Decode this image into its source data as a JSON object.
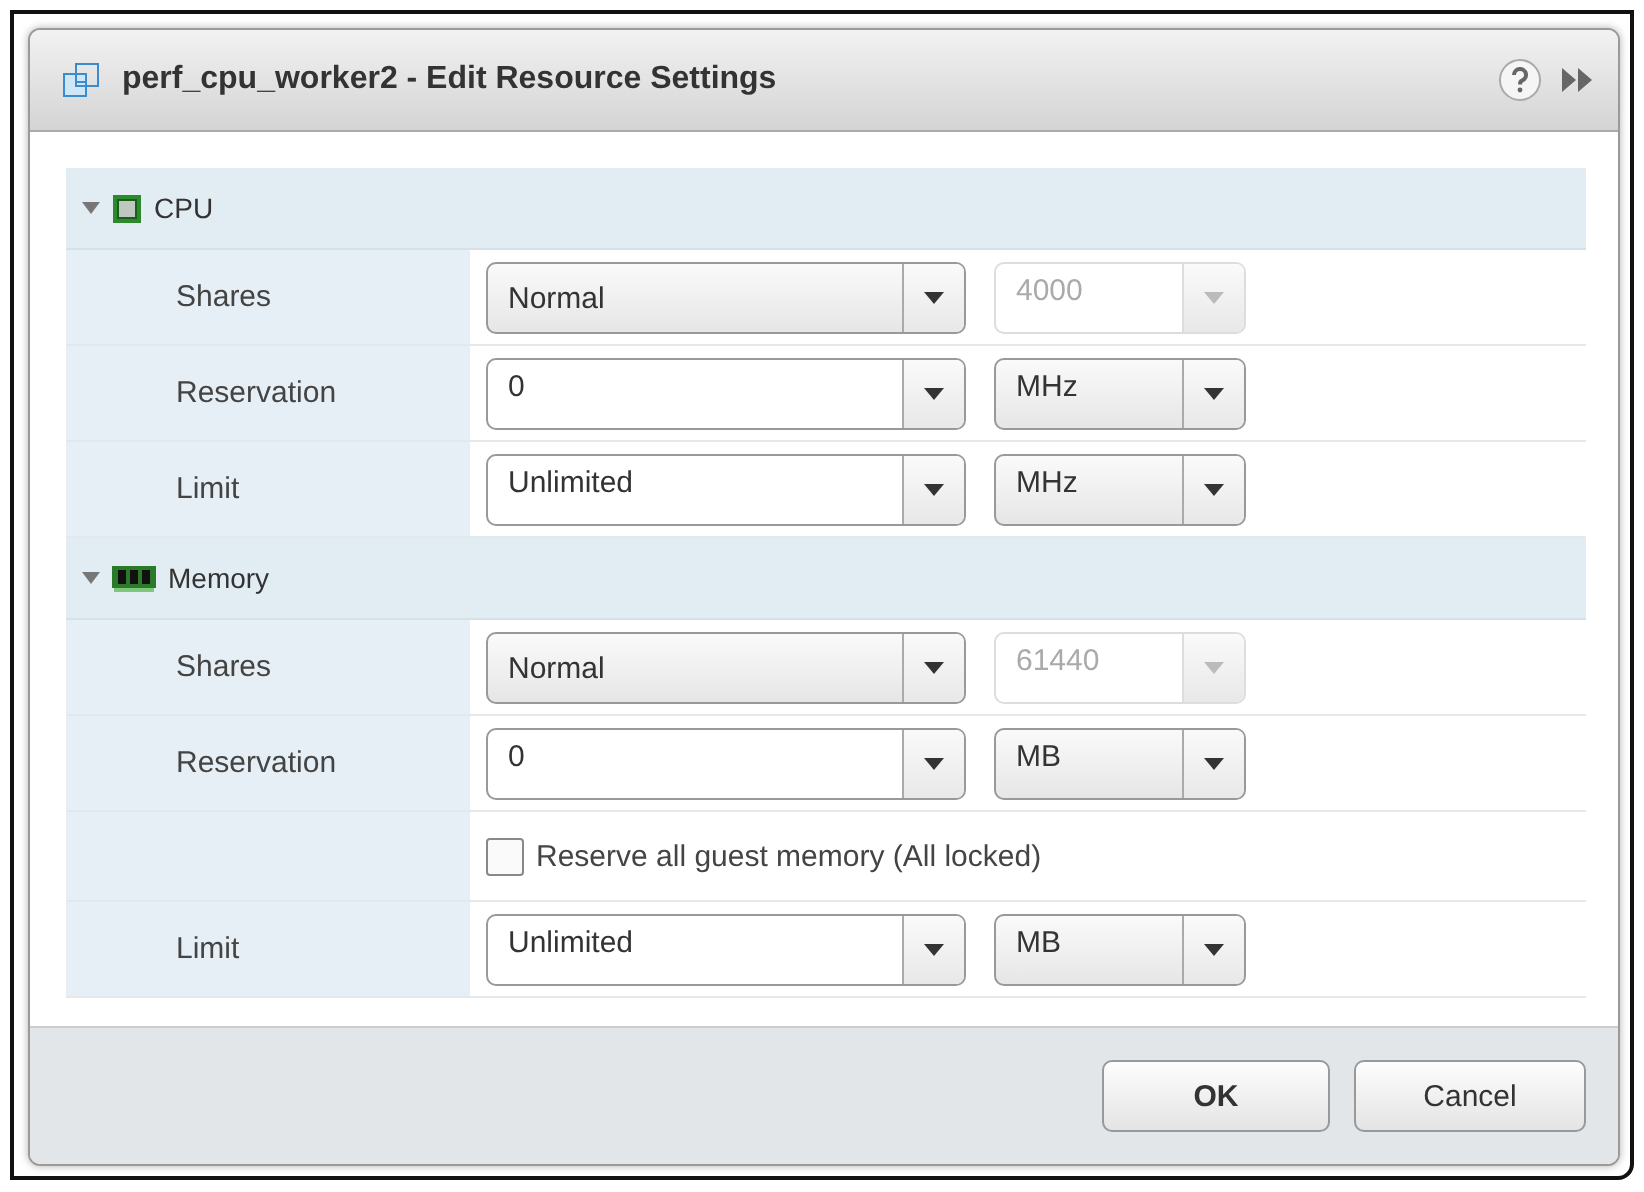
{
  "dialog": {
    "title": "perf_cpu_worker2 - Edit Resource Settings",
    "sections": [
      {
        "kind": "cpu",
        "name": "CPU",
        "expanded": true,
        "rows": [
          {
            "kind": "setting",
            "label": "Shares",
            "value": "Normal",
            "editable": false,
            "secondary": {
              "value": "4000",
              "disabled": true
            }
          },
          {
            "kind": "setting",
            "label": "Reservation",
            "value": "0",
            "editable": true,
            "secondary": {
              "value": "MHz",
              "disabled": false
            }
          },
          {
            "kind": "setting",
            "label": "Limit",
            "value": "Unlimited",
            "editable": true,
            "secondary": {
              "value": "MHz",
              "disabled": false
            }
          }
        ]
      },
      {
        "kind": "memory",
        "name": "Memory",
        "expanded": true,
        "rows": [
          {
            "kind": "setting",
            "label": "Shares",
            "value": "Normal",
            "editable": false,
            "secondary": {
              "value": "61440",
              "disabled": true
            }
          },
          {
            "kind": "setting",
            "label": "Reservation",
            "value": "0",
            "editable": true,
            "secondary": {
              "value": "MB",
              "disabled": false
            }
          },
          {
            "kind": "checkbox",
            "label": "Reserve all guest memory (All locked)",
            "checked": false
          },
          {
            "kind": "setting",
            "label": "Limit",
            "value": "Unlimited",
            "editable": true,
            "secondary": {
              "value": "MB",
              "disabled": false
            }
          }
        ]
      }
    ],
    "buttons": [
      {
        "label": "OK",
        "default": true
      },
      {
        "label": "Cancel",
        "default": false
      }
    ]
  }
}
